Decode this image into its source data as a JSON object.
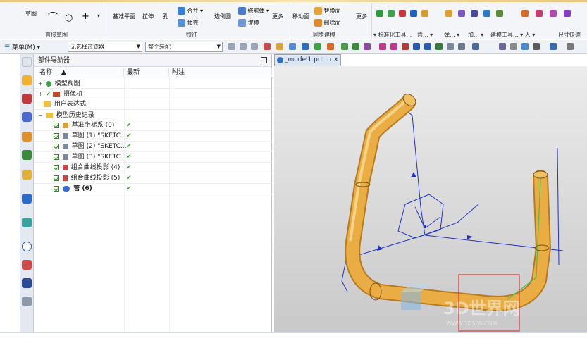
{
  "ribbon": {
    "groups": [
      {
        "label": "直接草图"
      },
      {
        "label": "特征"
      },
      {
        "label": "同步建模"
      },
      {
        "label": "标准化工具..."
      },
      {
        "label": "齿..."
      },
      {
        "label": "弹..."
      },
      {
        "label": "加..."
      },
      {
        "label": "建模工具..."
      },
      {
        "label": "尺寸快速"
      }
    ],
    "buttons": {
      "sketch": "草图",
      "datum_plane": "基准平面",
      "extrude": "拉伸",
      "hole": "孔",
      "unite": "合并",
      "shell": "抽壳",
      "edge_blend": "边倒圆",
      "trim_body": "修剪体",
      "draft": "拔模",
      "more1": "更多",
      "move_face": "移动面",
      "replace_face": "替换面",
      "delete_face": "删除面",
      "more2": "更多"
    }
  },
  "toolbar": {
    "menu_label": "菜单(M)",
    "filter_select": "无选择过滤器",
    "assembly_select": "整个装配"
  },
  "navigator": {
    "title": "部件导航器",
    "columns": {
      "name": "名称",
      "latest": "最新",
      "note": "附注"
    },
    "rows": [
      {
        "label": "模型视图",
        "check": ""
      },
      {
        "label": "摄像机",
        "check": ""
      },
      {
        "label": "用户表达式",
        "check": ""
      },
      {
        "label": "模型历史记录",
        "check": ""
      },
      {
        "label": "基准坐标系 (0)",
        "check": "✔"
      },
      {
        "label": "草图 (1) \"SKETC...",
        "check": "✔"
      },
      {
        "label": "草图 (2) \"SKETC...",
        "check": "✔"
      },
      {
        "label": "草图 (3) \"SKETC...",
        "check": "✔"
      },
      {
        "label": "组合曲线投影 (4)",
        "check": "✔"
      },
      {
        "label": "组合曲线投影 (5)",
        "check": "✔"
      },
      {
        "label": "管 (6)",
        "check": "✔"
      }
    ]
  },
  "viewport": {
    "tab_label": "_model1.prt",
    "watermark": "3D世界网",
    "watermark_url": "WWW.3DSJW.COM"
  },
  "colors": {
    "tube": "#e7a83a",
    "curve": "#2033c8",
    "selection_box": "#d93b3b"
  }
}
